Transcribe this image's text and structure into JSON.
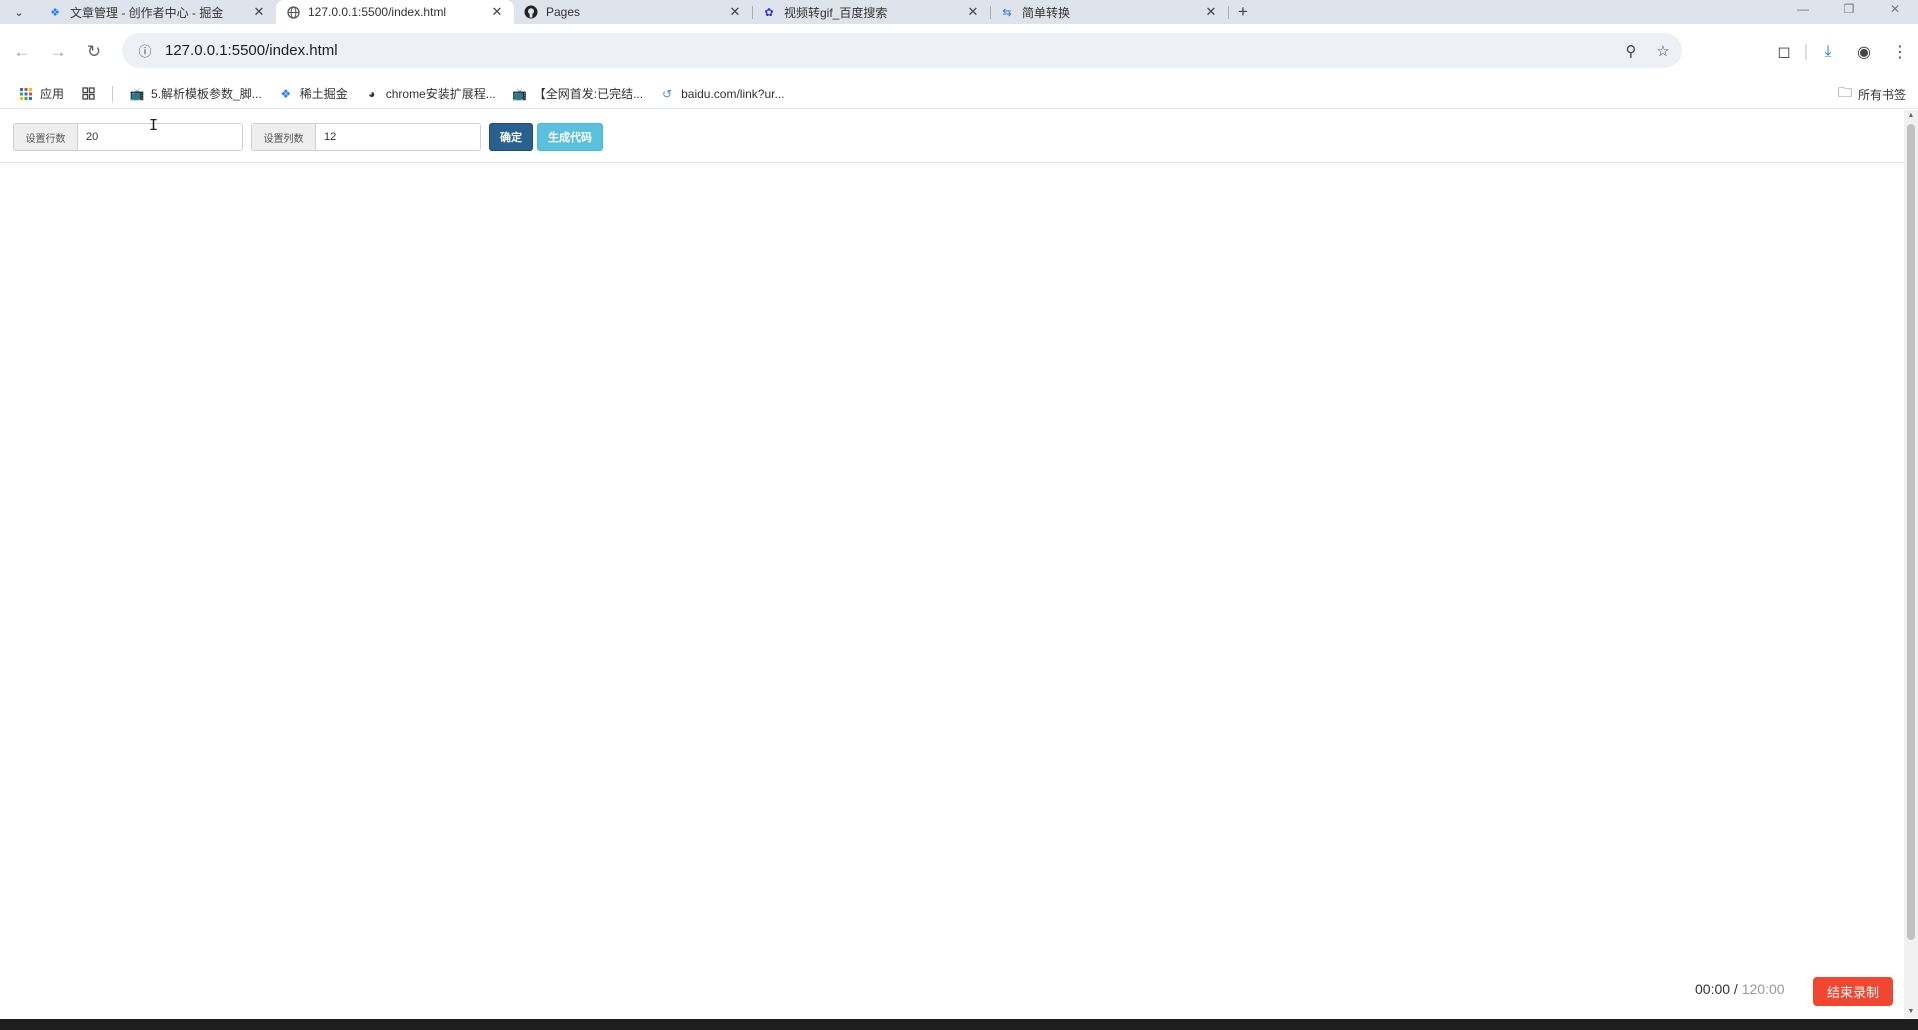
{
  "browser": {
    "tabs": [
      {
        "title": "文章管理 - 创作者中心 - 掘金",
        "icon": "juejin-icon",
        "active": false
      },
      {
        "title": "127.0.0.1:5500/index.html",
        "icon": "globe-icon",
        "active": true
      },
      {
        "title": "Pages",
        "icon": "github-icon",
        "active": false
      },
      {
        "title": "视频转gif_百度搜索",
        "icon": "baidu-icon",
        "active": false
      },
      {
        "title": "简单转换",
        "icon": "convert-icon",
        "active": false
      }
    ],
    "new_tab": "+",
    "address": "127.0.0.1:5500/index.html",
    "bookmarks": [
      {
        "label": "应用",
        "icon": "apps-grid-icon"
      },
      {
        "label": "",
        "icon": "tab-groups-icon"
      },
      {
        "label": "5.解析模板参数_脚...",
        "icon": "bilibili-icon"
      },
      {
        "label": "稀土掘金",
        "icon": "juejin-icon"
      },
      {
        "label": "chrome安装扩展程...",
        "icon": "globe-icon"
      },
      {
        "label": "【全网首发:已完结...",
        "icon": "bilibili-icon"
      },
      {
        "label": "baidu.com/link?ur...",
        "icon": "link-icon"
      }
    ],
    "all_bookmarks": "所有书签"
  },
  "form": {
    "rows_label": "设置行数",
    "rows_value": "20",
    "cols_label": "设置列数",
    "cols_value": "12",
    "confirm_label": "确定",
    "generate_label": "生成代码"
  },
  "recorder": {
    "elapsed": "00:00",
    "separator": " / ",
    "total": "120:00",
    "stop_label": "结束录制"
  },
  "colors": {
    "primary_button": "#286090",
    "info_button": "#5bc0de",
    "record_button": "#f1462f"
  }
}
